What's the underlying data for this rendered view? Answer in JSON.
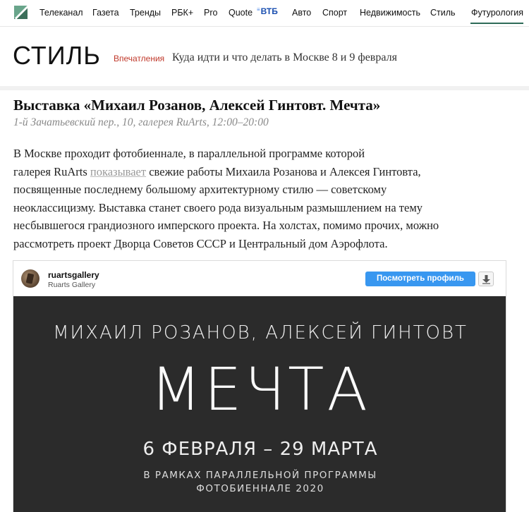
{
  "nav": {
    "items": [
      "Телеканал",
      "Газета",
      "Тренды",
      "РБК+",
      "Pro",
      "Quote"
    ],
    "vtb_label": "ВТБ",
    "items2": [
      "Авто",
      "Спорт",
      "Недвижимость",
      "Стиль",
      "Футурология"
    ]
  },
  "section": {
    "title": "СТИЛЬ",
    "rubric": "Впечатления",
    "headline": "Куда идти и что делать в Москве 8 и 9 февраля"
  },
  "article": {
    "title": "Выставка «Михаил Розанов, Алексей Гинтовт. Мечта»",
    "meta": "1-й Зачатьевский пер., 10, галерея RuArts, 12:00–20:00",
    "line1": "В Москве проходит фотобиеннале, в параллельной программе которой",
    "line2_a": "галерея RuArts ",
    "line2_link": "показывает",
    "line2_b": " свежие работы Михаила Розанова и Алексея Гинтовта,",
    "line3": "посвященные последнему большому архитектурному стилю — советскому",
    "line4": "неоклассицизму. Выставка станет своего рода визуальным размышлением на тему",
    "line5": "несбывшегося грандиозного имперского проекта. На холстах, помимо прочих, можно",
    "line6": "рассмотреть проект Дворца Советов СССР и Центральный дом Аэрофлота."
  },
  "embed": {
    "account": "ruartsgallery",
    "account_sub": "Ruarts Gallery",
    "profile_button": "Посмотреть профиль",
    "poster": {
      "names": "МИХАИЛ РОЗАНОВ, АЛЕКСЕЙ ГИНТОВТ",
      "title": "МЕЧТА",
      "dates": "6 ФЕВРАЛЯ – 29 МАРТА",
      "sub1": "В РАМКАХ ПАРАЛЛЕЛЬНОЙ ПРОГРАММЫ",
      "sub2": "ФОТОБИЕННАЛЕ 2020"
    }
  },
  "colors": {
    "accent": "#2d6b58",
    "rubric": "#c0392b",
    "instagram_blue": "#3897f0"
  }
}
